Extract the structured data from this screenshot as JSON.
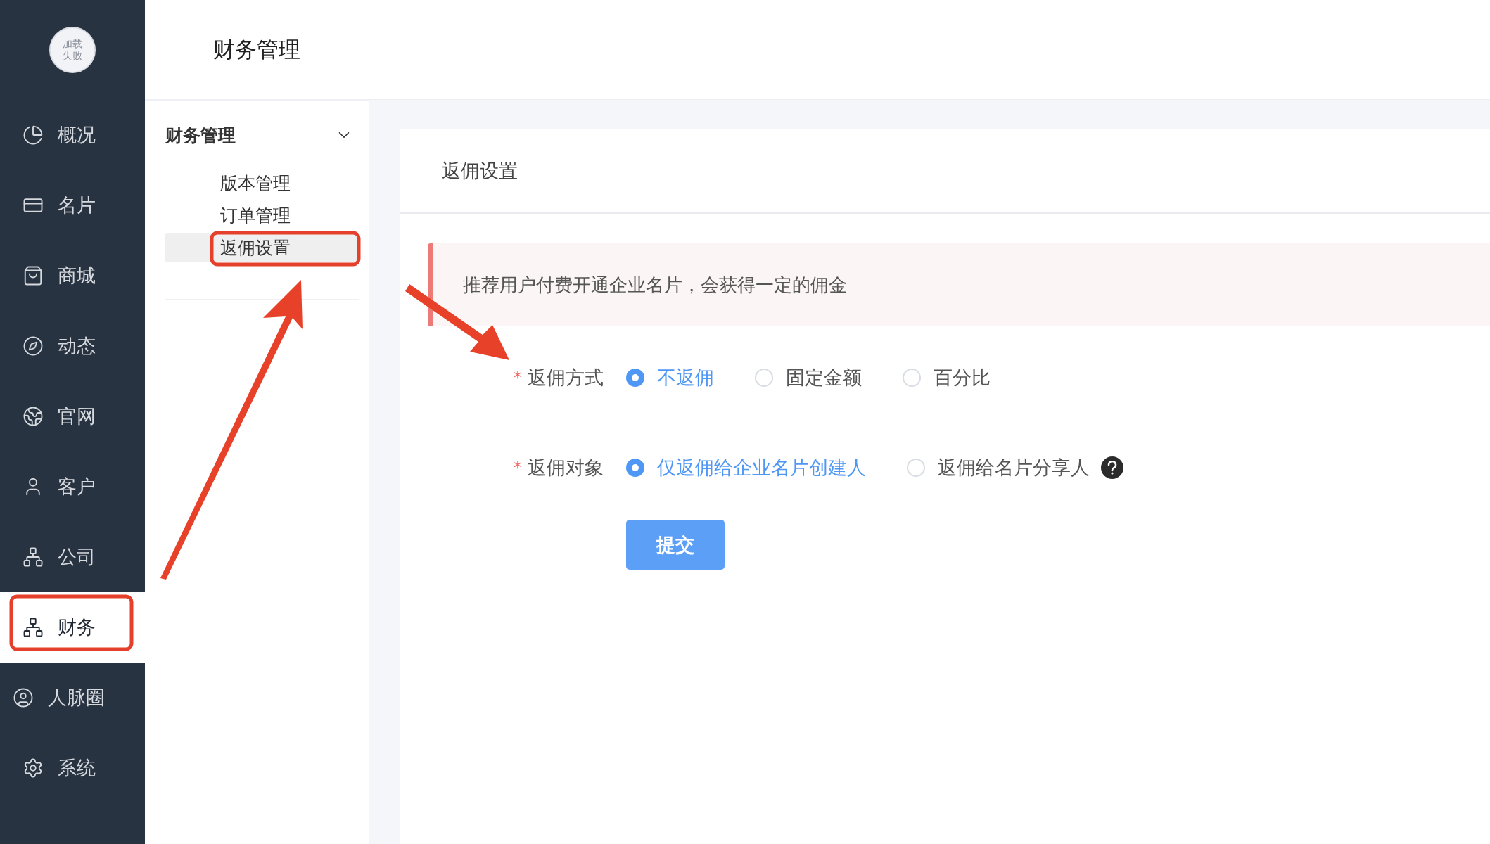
{
  "avatar": {
    "alt_text": "加载失败"
  },
  "nav": [
    {
      "label": "概况",
      "selected": false
    },
    {
      "label": "名片",
      "selected": false
    },
    {
      "label": "商城",
      "selected": false
    },
    {
      "label": "动态",
      "selected": false
    },
    {
      "label": "官网",
      "selected": false
    },
    {
      "label": "客户",
      "selected": false
    },
    {
      "label": "公司",
      "selected": false
    },
    {
      "label": "财务",
      "selected": true
    },
    {
      "label": "人脉圈",
      "selected": false
    },
    {
      "label": "系统",
      "selected": false
    }
  ],
  "submenu": {
    "title": "财务管理",
    "group": {
      "label": "财务管理",
      "expanded": true,
      "items": [
        {
          "label": "版本管理",
          "selected": false
        },
        {
          "label": "订单管理",
          "selected": false
        },
        {
          "label": "返佣设置",
          "selected": true
        }
      ]
    }
  },
  "card": {
    "title": "返佣设置",
    "alert": "推荐用户付费开通企业名片，会获得一定的佣金",
    "rows": [
      {
        "label": "返佣方式",
        "required_mark": "*",
        "options": [
          {
            "label": "不返佣",
            "selected": true
          },
          {
            "label": "固定金额",
            "selected": false
          },
          {
            "label": "百分比",
            "selected": false
          }
        ]
      },
      {
        "label": "返佣对象",
        "required_mark": "*",
        "help": true,
        "options": [
          {
            "label": "仅返佣给企业名片创建人",
            "selected": true
          },
          {
            "label": "返佣给名片分享人",
            "selected": false
          }
        ]
      }
    ],
    "submit": "提交"
  }
}
